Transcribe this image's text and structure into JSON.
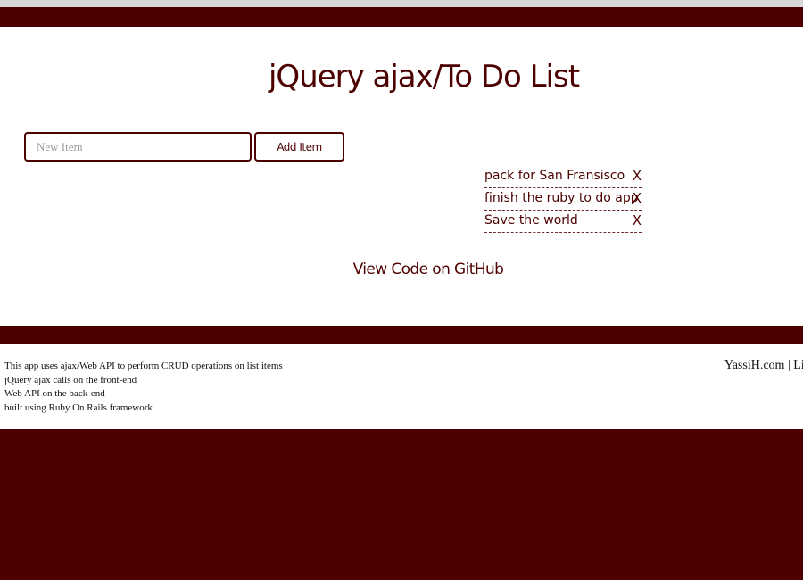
{
  "header": {
    "title": "jQuery ajax/To Do List"
  },
  "form": {
    "new_item_placeholder": "New Item",
    "new_item_value": "",
    "add_button_label": "Add Item"
  },
  "todos": [
    {
      "text": "pack for San Fransisco",
      "delete": "X"
    },
    {
      "text": "finish the ruby to do app",
      "delete": "X"
    },
    {
      "text": "Save the world",
      "delete": "X"
    }
  ],
  "github_link": "View Code on GitHub",
  "footer": {
    "lines": [
      "This app uses ajax/Web API to perform CRUD operations on list items",
      "jQuery ajax calls on the front-end",
      "Web API on the back-end",
      "built using Ruby On Rails framework"
    ],
    "site_link": "YassiH.com",
    "separator": " | ",
    "truncated_link": "Li"
  },
  "colors": {
    "brand": "#4d0000",
    "background": "#ffffff",
    "top_strip": "#d8d8d8"
  }
}
